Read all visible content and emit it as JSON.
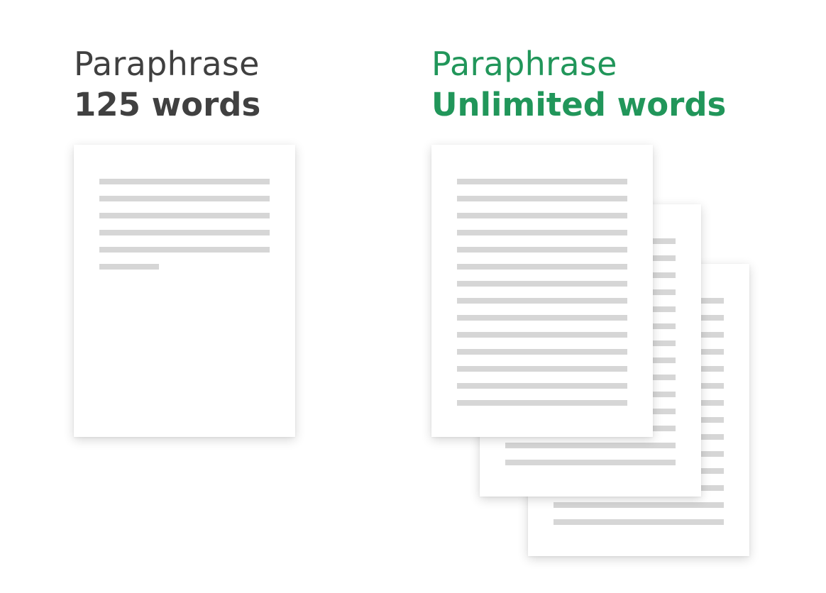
{
  "free_plan": {
    "title": "Paraphrase",
    "limit": "125 words",
    "page_text_lines": 6
  },
  "premium_plan": {
    "title": "Paraphrase",
    "limit": "Unlimited words",
    "accent_color": "#21965a",
    "pages_in_stack": 3,
    "page_text_lines": 14
  },
  "colors": {
    "free_text": "#404040",
    "premium_text": "#21965a",
    "text_line_placeholder": "#d6d6d6",
    "page_background": "#ffffff"
  }
}
